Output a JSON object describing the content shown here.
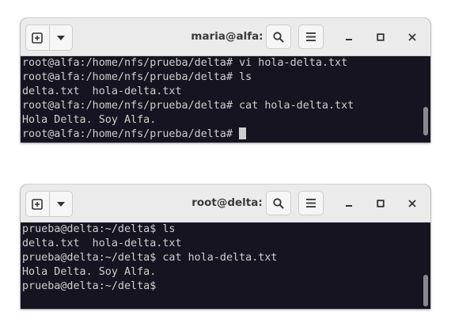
{
  "window1": {
    "title": "maria@alfa: ~",
    "lines": [
      "root@alfa:/home/nfs/prueba/delta# vi hola-delta.txt",
      "root@alfa:/home/nfs/prueba/delta# ls",
      "delta.txt  hola-delta.txt",
      "root@alfa:/home/nfs/prueba/delta# cat hola-delta.txt",
      "Hola Delta. Soy Alfa.",
      "root@alfa:/home/nfs/prueba/delta#"
    ]
  },
  "window2": {
    "title": "root@delta: ~",
    "lines": [
      "prueba@delta:~/delta$ ls",
      "delta.txt  hola-delta.txt",
      "prueba@delta:~/delta$ cat hola-delta.txt",
      "Hola Delta. Soy Alfa.",
      "prueba@delta:~/delta$"
    ]
  },
  "icons": {
    "new_tab": "new-tab-icon",
    "dropdown": "chevron-down-icon",
    "search": "search-icon",
    "menu": "hamburger-menu-icon",
    "minimize": "minimize-icon",
    "maximize": "maximize-icon",
    "close": "close-icon"
  },
  "colors": {
    "terminal_bg": "#171421",
    "terminal_fg": "#d0cfcc",
    "titlebar_bg": "#ebebeb"
  }
}
